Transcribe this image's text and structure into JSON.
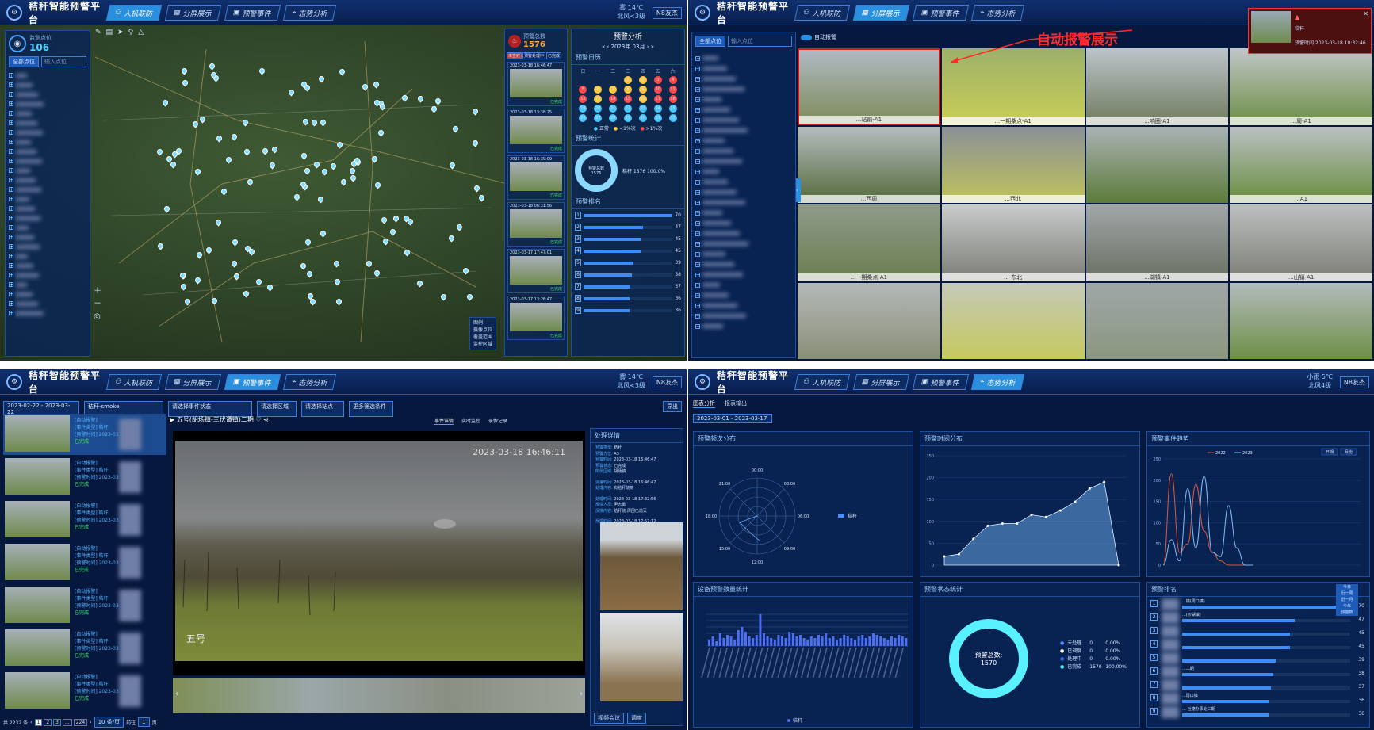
{
  "platform_title": "秸秆智能预警平台",
  "nav": {
    "renji": "人机联防",
    "fenping": "分屏展示",
    "yujing": "预警事件",
    "taishi": "态势分析"
  },
  "user": "N8友杰",
  "weather_q1": {
    "top": "雾 14℃",
    "bottom": "北风<3级"
  },
  "weather_q3": {
    "top": "雾 14℃",
    "bottom": "北风<3级"
  },
  "weather_q4": {
    "top": "小雨 5℃",
    "bottom": "北风4级"
  },
  "q1": {
    "site_label": "监测点位",
    "site_count": "106",
    "search_placeholder": "输入点位",
    "filter": "全部点位",
    "alarm_label": "预警总数",
    "alarm_count": "1576",
    "analysis_title": "预警分析",
    "calendar_title": "预警日历",
    "month": "2023年 03月",
    "weekdays": [
      "日",
      "一",
      "二",
      "三",
      "四",
      "五",
      "六"
    ],
    "legend_cal": [
      "正常",
      "<1%次",
      ">1%次"
    ],
    "stat_title": "预警统计",
    "donut_label": "预警总数",
    "donut_value": "1576",
    "donut_legend": "秸秆 1576 100.0%",
    "rank_title": "预警排名",
    "rank_values": [
      "70",
      "47",
      "45",
      "45",
      "39",
      "38",
      "37",
      "36",
      "36"
    ],
    "list_items": [
      {
        "time": "2023-03-18 16:46:47",
        "status": "已完成"
      },
      {
        "time": "2023-03-18 13:38:25",
        "status": "已完成"
      },
      {
        "time": "2023-03-18 16:39:09",
        "status": "已完成"
      },
      {
        "time": "2023-03-18 06:31:56",
        "status": "已完成"
      },
      {
        "time": "2023-03-17 17:47:01",
        "status": "已完成"
      },
      {
        "time": "2023-03-17 13:26:47",
        "status": "已完成"
      }
    ],
    "tabs": [
      "未签收",
      "预警处理中",
      "已完成"
    ],
    "legend_map": [
      "图例",
      "摄像点位",
      "覆盖范围",
      "监控区域"
    ]
  },
  "q2": {
    "annotation": "自动报警展示",
    "toggle": "自动报警",
    "search_placeholder": "输入点位",
    "filter": "全部点位",
    "alert_popup": {
      "line1": "秸秆",
      "line3": "预警时间 2023-03-18 10:32:46"
    },
    "cam_captions": [
      "...站前-A1",
      "...一期桑点-A1",
      "...响圈-A1",
      "...周-A1",
      "...西周",
      "...西北",
      "",
      "...A1",
      "...一期桑点-A1",
      "...-东北",
      "...湖镇-A1",
      "...山镇-A1",
      "",
      "",
      "",
      ""
    ]
  },
  "q3": {
    "date_range": "2023-02-22 - 2023-03-22",
    "type_select": "秸秆-smoke",
    "sel_status": "请选择事件状态",
    "sel_area": "请选择区域",
    "sel_site": "请选择站点",
    "more": "更多筛选条件",
    "export": "导出",
    "video_title": "五号(胡场镇-三伏谭镇)二期",
    "tabs": [
      "事件详情",
      "实时监控",
      "录像记录"
    ],
    "timestamp": "2023-03-18 16:46:11",
    "overlay_name": "五号",
    "pager": "共 2232 条",
    "page_size": "10 条/页",
    "goto": "前往",
    "goto_page": "1",
    "goto_suffix": "页",
    "pages": [
      "1",
      "2",
      "3",
      "...",
      "224"
    ],
    "process_title": "处理详情",
    "process": [
      {
        "k": "预警类型:",
        "v": "秸秆"
      },
      {
        "k": "预警方位:",
        "v": "A3"
      },
      {
        "k": "预警时间:",
        "v": "2023-03-18 16:46:47"
      },
      {
        "k": "预警状态:",
        "v": "已完成"
      },
      {
        "k": "所属区域:",
        "v": "胡场镇"
      },
      {
        "k": "派遣时间:",
        "v": "2023-03-18 16:46:47"
      },
      {
        "k": "处理内容:",
        "v": "有秸秆烧荒"
      },
      {
        "k": "处理时间:",
        "v": "2023-03-18 17:32:56"
      },
      {
        "k": "反馈人员:",
        "v": "尹志勇"
      },
      {
        "k": "反馈内容:",
        "v": "秸秆烧,周围已熄灭"
      },
      {
        "k": "反馈时间:",
        "v": "2023-03-18 17:57:12"
      }
    ],
    "event_items": [
      {
        "tag": "[自动报警]",
        "type": "[事件类型] 秸秆",
        "time": "[预警时间] 2023-03",
        "status": "已完成"
      },
      {
        "tag": "[自动报警]",
        "type": "[事件类型] 秸秆",
        "time": "[预警时间] 2023-03",
        "status": "已完成"
      },
      {
        "tag": "[自动报警]",
        "type": "[事件类型] 秸秆",
        "time": "[预警时间] 2023-03",
        "status": "已完成"
      },
      {
        "tag": "[自动报警]",
        "type": "[事件类型] 秸秆",
        "time": "[预警时间] 2023-03",
        "status": "已完成"
      },
      {
        "tag": "[自动报警]",
        "type": "[事件类型] 秸秆",
        "time": "[预警时间] 2023-03",
        "status": "已完成"
      },
      {
        "tag": "[自动报警]",
        "type": "[事件类型] 秸秆",
        "time": "[预警时间] 2023-03",
        "status": "已完成"
      },
      {
        "tag": "[自动报警]",
        "type": "[事件类型] 秸秆",
        "time": "[预警时间] 2023-03",
        "status": "已完成"
      }
    ],
    "bottom_btns": [
      "视频会议",
      "调度"
    ]
  },
  "q4": {
    "tabs": [
      "图表分析",
      "报表输出"
    ],
    "date_range": "2023-03-01 - 2023-03-17",
    "p1_title": "预警频次分布",
    "p2_title": "预警时间分布",
    "p3_title": "预警事件趋势",
    "p4_title": "设备预警数量统计",
    "p5_title": "预警状态统计",
    "p6_title": "预警排名",
    "radar_labels": [
      "00:00",
      "03:00",
      "06:00",
      "09:00",
      "12:00",
      "15:00",
      "18:00",
      "21:00"
    ],
    "radar_legend": "秸秆",
    "p3_legend": [
      "2022",
      "2023"
    ],
    "p3_btns": [
      "日期",
      "月份"
    ],
    "status_total_label": "预警总数:",
    "status_total": "1570",
    "status_rows": [
      {
        "name": "未处理",
        "count": "0",
        "pct": "0.00%",
        "color": "#4c8dff"
      },
      {
        "name": "已调度",
        "count": "0",
        "pct": "0.00%",
        "color": "#ffffff"
      },
      {
        "name": "处理中",
        "count": "0",
        "pct": "0.00%",
        "color": "#3b6cf0"
      },
      {
        "name": "已完成",
        "count": "1570",
        "pct": "100.00%",
        "color": "#59f0ff"
      }
    ],
    "p4_legend": "秸秆",
    "rank_rows": [
      "70",
      "47",
      "45",
      "45",
      "39",
      "38",
      "37",
      "36",
      "36"
    ],
    "rank_names": [
      "...镇(周口镇)",
      "...(沙湖镇)",
      "",
      "",
      "",
      "...二期",
      "",
      "...周口镇",
      "...-社德办事处二期"
    ],
    "rank_dd": [
      "今日",
      "近一周",
      "近一月",
      "今年",
      "预警数"
    ]
  },
  "chart_data": [
    {
      "type": "line",
      "title": "预警时间分布",
      "x": [
        1,
        2,
        3,
        4,
        5,
        6,
        7,
        8,
        9,
        10,
        11,
        12,
        13
      ],
      "series": [
        {
          "values": [
            20,
            25,
            60,
            90,
            95,
            95,
            115,
            110,
            125,
            145,
            175,
            190,
            0
          ]
        }
      ],
      "ylim": [
        0,
        250
      ],
      "yticks": [
        0,
        50,
        100,
        150,
        200,
        250
      ]
    },
    {
      "type": "line",
      "title": "预警事件趋势",
      "x": [
        1,
        2,
        3,
        4,
        5,
        6,
        7,
        8,
        9,
        10,
        11,
        12
      ],
      "series": [
        {
          "name": "2022",
          "values": [
            0,
            215,
            30,
            50,
            190,
            80,
            30,
            10,
            0,
            0,
            0,
            0
          ]
        },
        {
          "name": "2023",
          "values": [
            0,
            60,
            10,
            180,
            40,
            210,
            30,
            20,
            140,
            40,
            0,
            0
          ]
        }
      ],
      "ylim": [
        0,
        250
      ],
      "yticks": [
        0,
        50,
        100,
        150,
        200,
        250
      ]
    }
  ]
}
